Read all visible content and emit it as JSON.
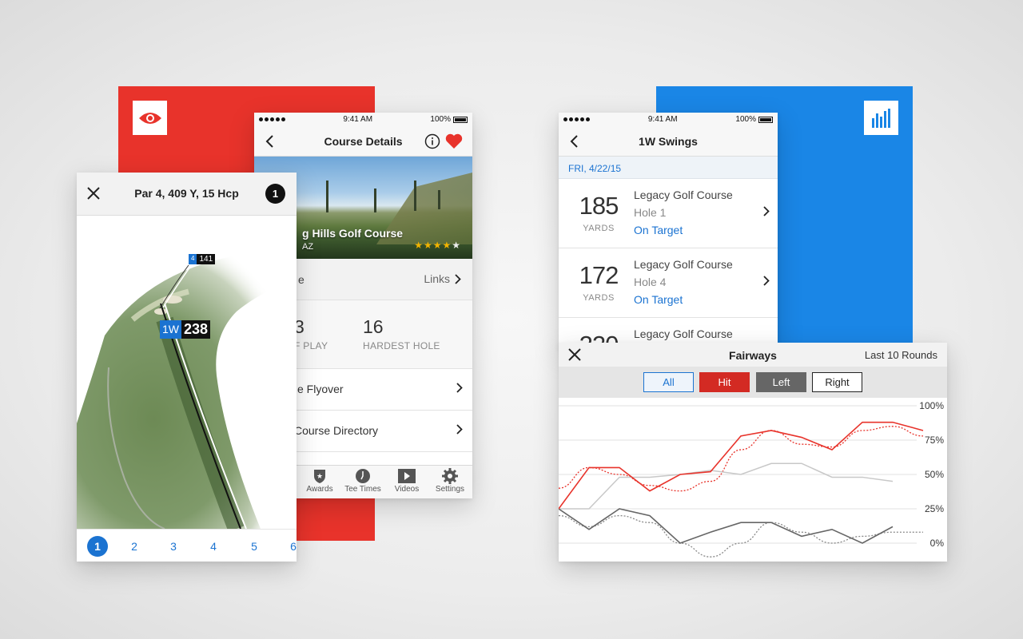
{
  "course_details": {
    "status": {
      "time": "9:41 AM",
      "battery": "100%"
    },
    "title": "Course Details",
    "hero": {
      "name": "g Hills Golf Course",
      "location": "AZ",
      "rating": 4,
      "rating_max": 5
    },
    "links_row": {
      "left": "e",
      "right": "Links"
    },
    "stats": [
      {
        "value": "3",
        "label": "F PLAY"
      },
      {
        "value": "16",
        "label": "HARDEST HOLE"
      }
    ],
    "menu": [
      {
        "label": "e Flyover"
      },
      {
        "label": "Course Directory"
      }
    ],
    "tabs": [
      {
        "label": "Awards",
        "icon": "shield-star-icon"
      },
      {
        "label": "Tee Times",
        "icon": "clock-icon"
      },
      {
        "label": "Videos",
        "icon": "play-icon"
      },
      {
        "label": "Settings",
        "icon": "gear-icon"
      }
    ]
  },
  "hole_map": {
    "title": "Par 4, 409 Y, 15 Hcp",
    "hole_badge": "1",
    "flag_yards": "141",
    "flag_club": "4",
    "club": "1W",
    "distance": "238",
    "holes": [
      "1",
      "2",
      "3",
      "4",
      "5",
      "6"
    ],
    "active_hole": "1"
  },
  "swings": {
    "status": {
      "time": "9:41 AM",
      "battery": "100%"
    },
    "title": "1W Swings",
    "date": "FRI, 4/22/15",
    "items": [
      {
        "yards": "185",
        "unit": "YARDS",
        "course": "Legacy Golf Course",
        "hole": "Hole 1",
        "result": "On Target"
      },
      {
        "yards": "172",
        "unit": "YARDS",
        "course": "Legacy Golf Course",
        "hole": "Hole 4",
        "result": "On Target"
      },
      {
        "yards": "220",
        "unit": "YARDS",
        "course": "Legacy Golf Course",
        "hole": "",
        "result": ""
      }
    ]
  },
  "fairways": {
    "title": "Fairways",
    "subtitle": "Last 10 Rounds",
    "filters": [
      {
        "label": "All",
        "style": "all"
      },
      {
        "label": "Hit",
        "style": "hit"
      },
      {
        "label": "Left",
        "style": "left"
      },
      {
        "label": "Right",
        "style": "right"
      }
    ]
  },
  "colors": {
    "red": "#e8332b",
    "blue": "#1a86e6",
    "link_blue": "#1b73d1",
    "gray": "#666666",
    "light_gray": "#c8c8c8"
  },
  "chart_data": {
    "type": "line",
    "title": "Fairways",
    "ylim": [
      0,
      100
    ],
    "y_ticks": [
      "100%",
      "75%",
      "50%",
      "25%",
      "0%"
    ],
    "x": [
      1,
      2,
      3,
      4,
      5,
      6,
      7,
      8,
      9,
      10,
      11,
      12,
      13
    ],
    "series": [
      {
        "name": "Hit",
        "color": "#e8332b",
        "values": [
          25,
          55,
          55,
          38,
          50,
          52,
          78,
          82,
          77,
          68,
          88,
          88,
          82
        ]
      },
      {
        "name": "",
        "color": "#c8c8c8",
        "values": [
          25,
          25,
          48,
          48,
          50,
          53,
          50,
          58,
          58,
          48,
          48,
          45
        ]
      },
      {
        "name": "Left",
        "color": "#666666",
        "values": [
          25,
          10,
          25,
          20,
          0,
          8,
          15,
          15,
          5,
          10,
          0,
          12
        ]
      }
    ],
    "trend": [
      {
        "color": "#e8332b",
        "values": [
          40,
          55,
          50,
          42,
          38,
          45,
          68,
          82,
          72,
          70,
          82,
          85,
          78
        ]
      },
      {
        "color": "#888888",
        "values": [
          20,
          12,
          20,
          15,
          0,
          -10,
          0,
          15,
          8,
          0,
          5,
          8,
          8
        ]
      }
    ]
  }
}
